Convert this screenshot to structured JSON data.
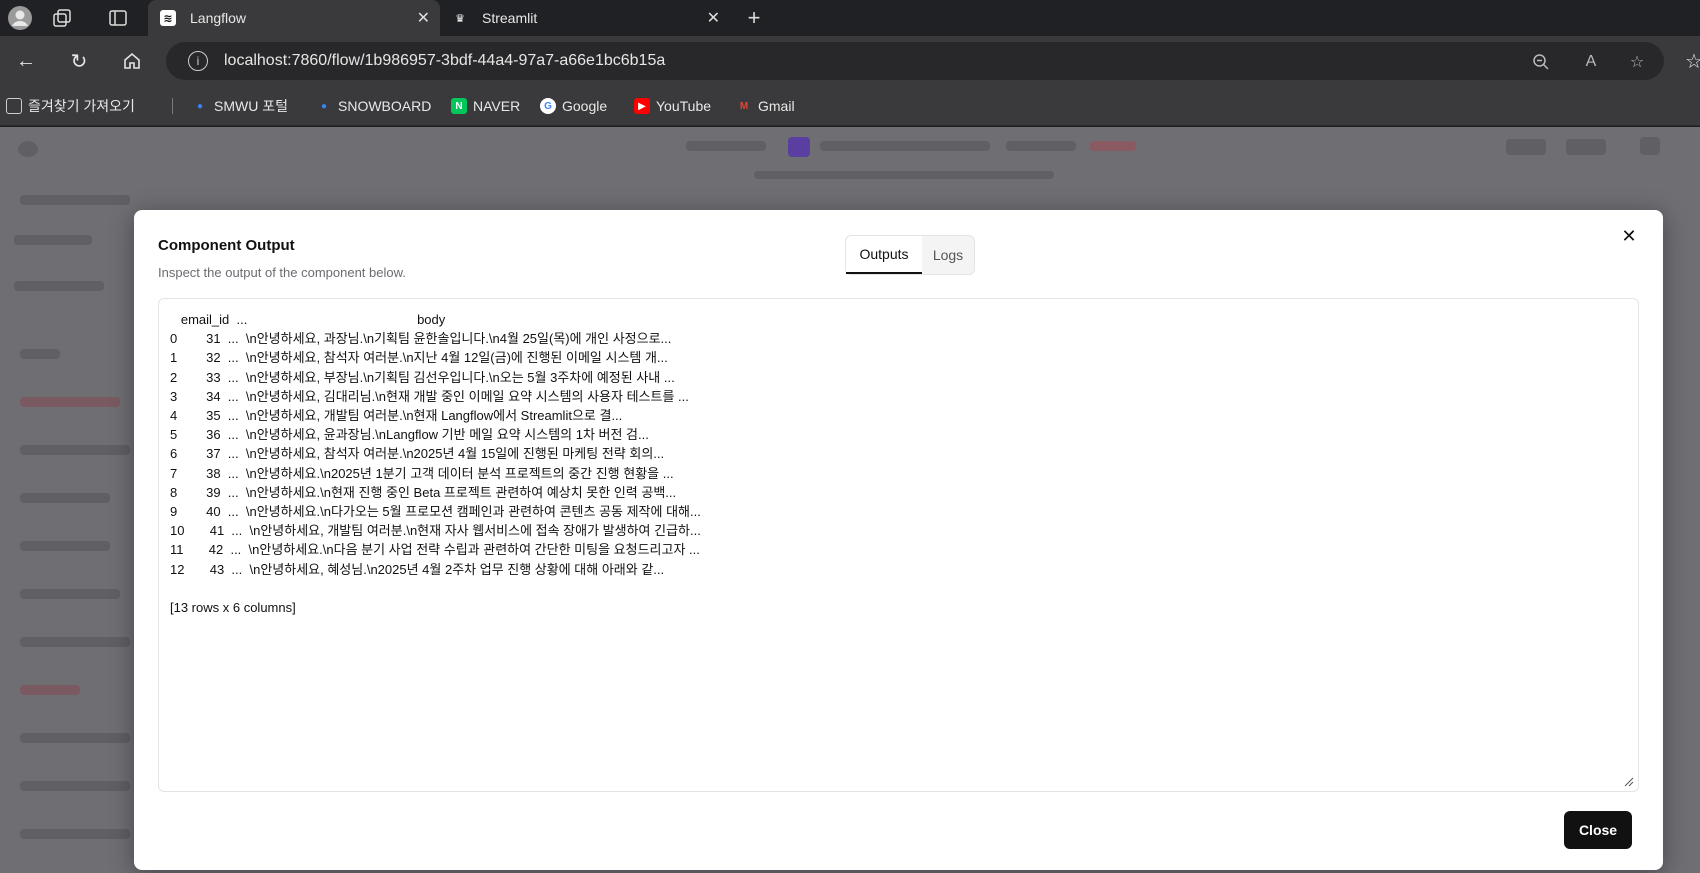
{
  "browser": {
    "tabs": [
      {
        "title": "Langflow"
      },
      {
        "title": "Streamlit"
      }
    ],
    "url": "localhost:7860/flow/1b986957-3bdf-44a4-97a7-a66e1bc6b15a",
    "bookmarks": [
      {
        "label": "즐겨찾기 가져오기"
      },
      {
        "label": "SMWU 포털"
      },
      {
        "label": "SNOWBOARD"
      },
      {
        "label": "NAVER"
      },
      {
        "label": "Google"
      },
      {
        "label": "YouTube"
      },
      {
        "label": "Gmail"
      }
    ]
  },
  "modal": {
    "title": "Component Output",
    "subtitle": "Inspect the output of the component below.",
    "tabs": {
      "outputs": "Outputs",
      "logs": "Logs"
    },
    "close_label": "Close",
    "output_lines": [
      "   email_id  ...                                               body",
      "0        31  ...  \\n안녕하세요, 과장님.\\n기획팀 윤한솔입니다.\\n4월 25일(목)에 개인 사정으로...",
      "1        32  ...  \\n안녕하세요, 참석자 여러분.\\n지난 4월 12일(금)에 진행된 이메일 시스템 개...",
      "2        33  ...  \\n안녕하세요, 부장님.\\n기획팀 김선우입니다.\\n오는 5월 3주차에 예정된 사내 ...",
      "3        34  ...  \\n안녕하세요, 김대리님.\\n현재 개발 중인 이메일 요약 시스템의 사용자 테스트를 ...",
      "4        35  ...  \\n안녕하세요, 개발팀 여러분.\\n현재 Langflow에서 Streamlit으로 결...",
      "5        36  ...  \\n안녕하세요, 윤과장님.\\nLangflow 기반 메일 요약 시스템의 1차 버전 검...",
      "6        37  ...  \\n안녕하세요, 참석자 여러분.\\n2025년 4월 15일에 진행된 마케팅 전략 회의...",
      "7        38  ...  \\n안녕하세요.\\n2025년 1분기 고객 데이터 분석 프로젝트의 중간 진행 현황을 ...",
      "8        39  ...  \\n안녕하세요.\\n현재 진행 중인 Beta 프로젝트 관련하여 예상치 못한 인력 공백...",
      "9        40  ...  \\n안녕하세요.\\n다가오는 5월 프로모션 캠페인과 관련하여 콘텐츠 공동 제작에 대해...",
      "10       41  ...  \\n안녕하세요, 개발팀 여러분.\\n현재 자사 웹서비스에 접속 장애가 발생하여 긴급하...",
      "11       42  ...  \\n안녕하세요.\\n다음 분기 사업 전략 수립과 관련하여 간단한 미팅을 요청드리고자 ...",
      "12       43  ...  \\n안녕하세요, 혜성님.\\n2025년 4월 2주차 업무 진행 상황에 대해 아래와 같...",
      "",
      "[13 rows x 6 columns]"
    ]
  }
}
